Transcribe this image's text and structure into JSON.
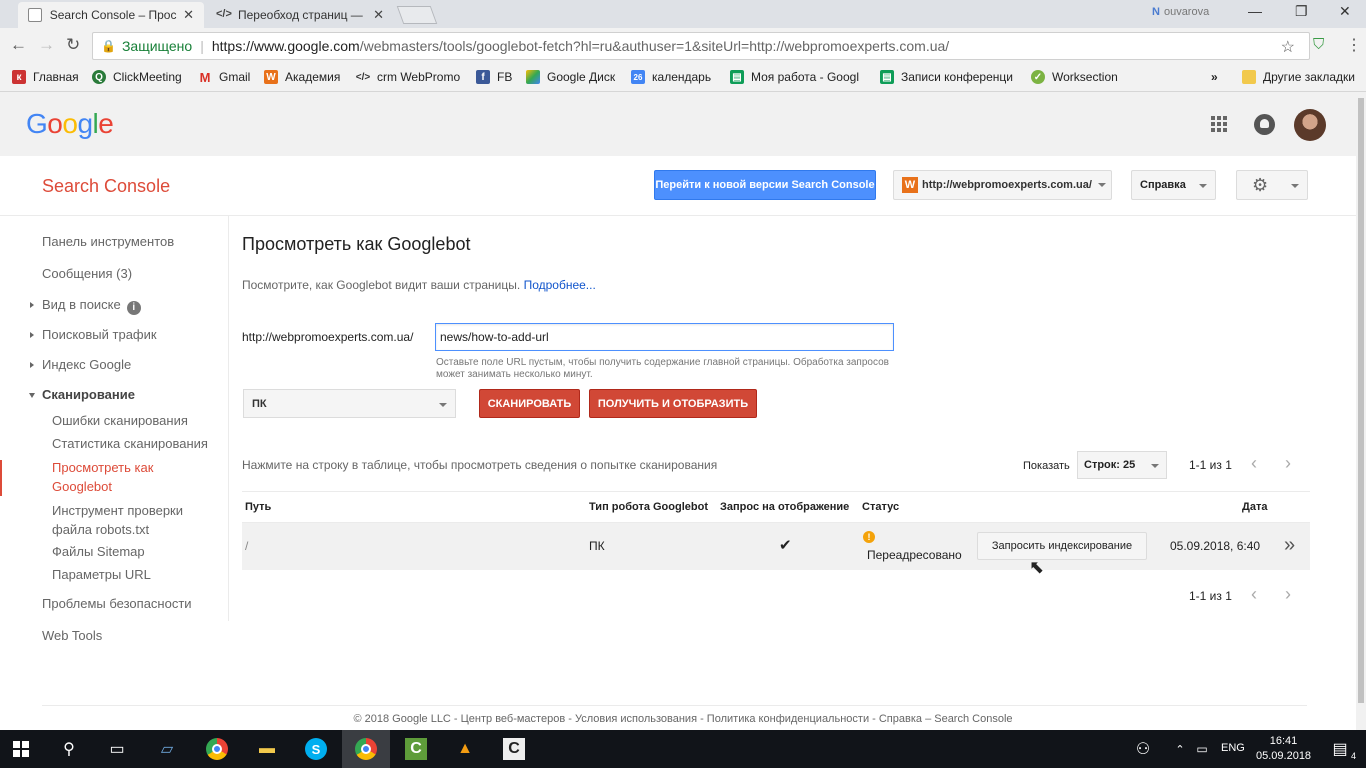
{
  "browser": {
    "tabs": [
      {
        "title": "Search Console – Просм",
        "active": true
      },
      {
        "title": "Переобход страниц — I",
        "active": false
      }
    ],
    "window_user": "ouvarova",
    "secure_label": "Защищено",
    "url_host": "https://www.google.com",
    "url_rest": "/webmasters/tools/googlebot-fetch?hl=ru&authuser=1&siteUrl=http://webpromoexperts.com.ua/",
    "bookmarks": [
      {
        "label": "Главная",
        "icon": "home-bookmark-icon"
      },
      {
        "label": "ClickMeeting",
        "icon": "clickmeeting-icon"
      },
      {
        "label": "Gmail",
        "icon": "gmail-icon"
      },
      {
        "label": "Академия",
        "icon": "academy-icon"
      },
      {
        "label": "crm WebPromo",
        "icon": "code-icon"
      },
      {
        "label": "FB",
        "icon": "facebook-icon"
      },
      {
        "label": "Google Диск",
        "icon": "google-drive-icon"
      },
      {
        "label": "календарь",
        "icon": "calendar-icon"
      },
      {
        "label": "Моя работа - Googl",
        "icon": "sheets-icon"
      },
      {
        "label": "Записи конференци",
        "icon": "sheets-icon"
      },
      {
        "label": "Worksection",
        "icon": "worksection-icon"
      }
    ],
    "bookmarks_more": "»",
    "other_bookmarks": "Другие закладки"
  },
  "google": {
    "logo_letters": [
      {
        "ch": "G",
        "color": "#4285f4"
      },
      {
        "ch": "o",
        "color": "#ea4335"
      },
      {
        "ch": "o",
        "color": "#fbbc05"
      },
      {
        "ch": "g",
        "color": "#4285f4"
      },
      {
        "ch": "l",
        "color": "#34a853"
      },
      {
        "ch": "e",
        "color": "#ea4335"
      }
    ]
  },
  "console": {
    "title": "Search Console",
    "new_version_button": "Перейти к новой версии Search Console",
    "site": "http://webpromoexperts.com.ua/",
    "help": "Справка"
  },
  "sidebar": {
    "items": [
      {
        "label": "Панель инструментов"
      },
      {
        "label": "Сообщения (3)"
      },
      {
        "label": "Вид в поиске"
      },
      {
        "label": "Поисковый трафик"
      },
      {
        "label": "Индекс Google"
      },
      {
        "label": "Сканирование"
      },
      {
        "label": "Ошибки сканирования"
      },
      {
        "label": "Статистика сканирования"
      },
      {
        "label": "Просмотреть как Googlebot"
      },
      {
        "label": "Инструмент проверки файла robots.txt"
      },
      {
        "label": "Файлы Sitemap"
      },
      {
        "label": "Параметры URL"
      },
      {
        "label": "Проблемы безопасности"
      },
      {
        "label": "Web Tools"
      }
    ]
  },
  "main": {
    "heading": "Просмотреть как Googlebot",
    "intro": "Посмотрите, как Googlebot видит ваши страницы.",
    "intro_link": "Подробнее...",
    "url_prefix": "http://webpromoexperts.com.ua/",
    "url_value": "news/how-to-add-url",
    "hint": "Оставьте поле URL пустым, чтобы получить содержание главной страницы. Обработка запросов может занимать несколько минут.",
    "device": "ПК",
    "crawl_button": "СКАНИРОВАТЬ",
    "render_button": "ПОЛУЧИТЬ И ОТОБРАЗИТЬ",
    "table_hint": "Нажмите на строку в таблице, чтобы просмотреть сведения о попытке сканирования",
    "show_label": "Показать",
    "rows_select": "Строк: 25",
    "pager": "1-1 из 1",
    "columns": {
      "path": "Путь",
      "bot_type": "Тип робота Googlebot",
      "render": "Запрос на отображение",
      "status": "Статус",
      "date": "Дата"
    },
    "rows": [
      {
        "path": "/",
        "bot_type": "ПК",
        "render": "✔",
        "status": "Переадресовано",
        "request_button": "Запросить индексирование",
        "date": "05.09.2018, 6:40",
        "more": "»"
      }
    ]
  },
  "footer": {
    "text": "© 2018 Google LLC - Центр веб-мастеров - Условия использования - Политика конфиденциальности - Справка – Search Console"
  },
  "taskbar": {
    "lang": "ENG",
    "time": "16:41",
    "date": "05.09.2018",
    "notifications": "4"
  }
}
